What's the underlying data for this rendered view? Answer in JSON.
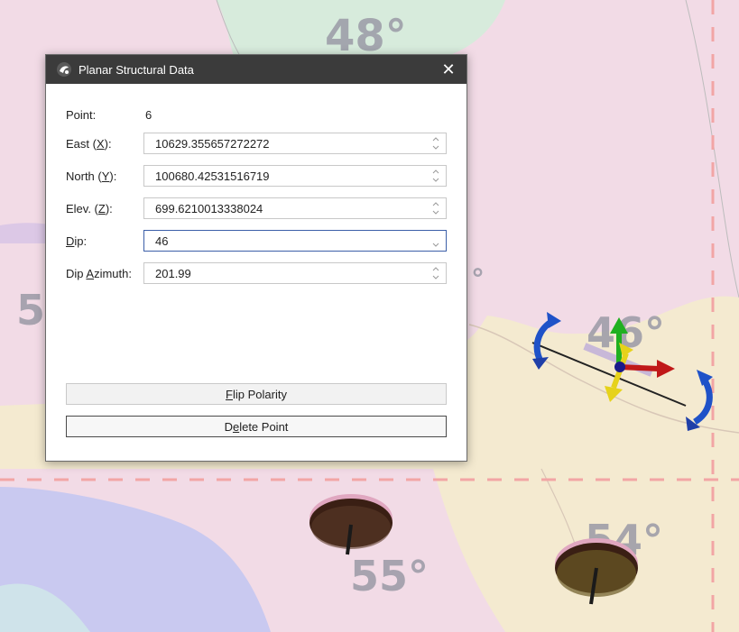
{
  "window": {
    "title": "Planar Structural Data",
    "close_glyph": "✕"
  },
  "fields": {
    "point": {
      "label": "Point:",
      "value": "6"
    },
    "east": {
      "label_pre": "East (",
      "label_key": "X",
      "label_post": "):",
      "value": "10629.355657272272"
    },
    "north": {
      "label_pre": "North (",
      "label_key": "Y",
      "label_post": "):",
      "value": "100680.42531516719"
    },
    "elev": {
      "label_pre": "Elev. (",
      "label_key": "Z",
      "label_post": "):",
      "value": "699.6210013338024"
    },
    "dip": {
      "label_key": "D",
      "label_post": "ip:",
      "value": "46"
    },
    "dip_azimuth": {
      "label_pre": "Dip ",
      "label_key": "A",
      "label_post": "zimuth:",
      "value": "201.99"
    }
  },
  "buttons": {
    "flip": {
      "key": "F",
      "rest": "lip Polarity"
    },
    "delete": {
      "pre": "D",
      "key": "e",
      "rest": "lete Point"
    }
  },
  "map": {
    "labels": [
      "48°",
      "5",
      "°",
      "46°",
      "54°",
      "55°"
    ],
    "colors": {
      "pink": "#f2dbe6",
      "green": "#d7ebdc",
      "lilac": "#dcc8e6",
      "tan": "#f4ead0",
      "blue": "#c9c9f0",
      "teal": "#cfe3ea",
      "dash": "#f2a5a5"
    }
  }
}
